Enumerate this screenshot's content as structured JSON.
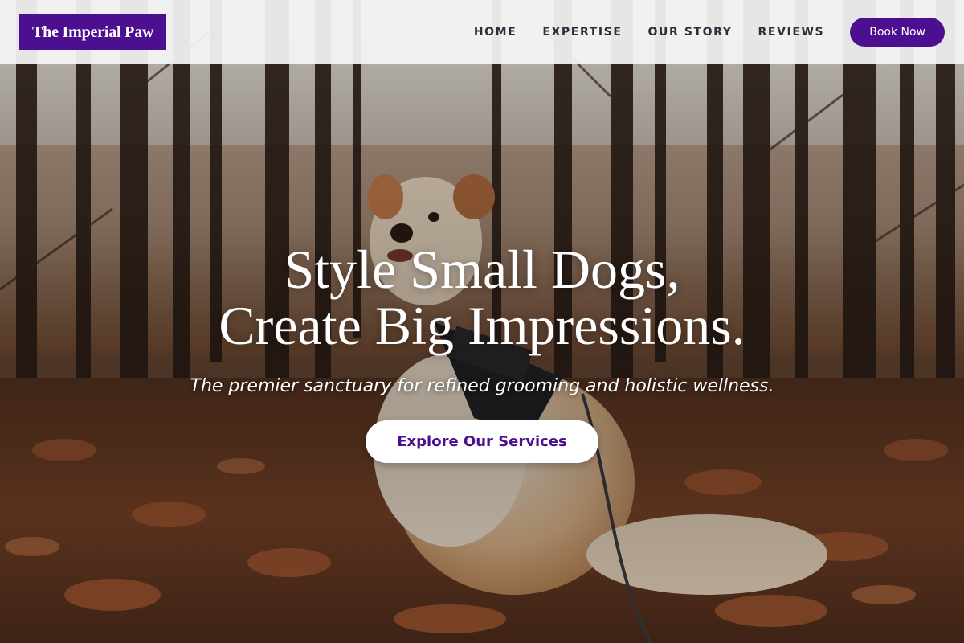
{
  "brand": {
    "name": "The Imperial Paw",
    "color": "#4b0f8f"
  },
  "nav": {
    "links": [
      "HOME",
      "EXPERTISE",
      "OUR STORY",
      "REVIEWS"
    ],
    "cta_label": "Book Now"
  },
  "hero": {
    "headline_line1": "Style Small Dogs,",
    "headline_line2": "Create Big Impressions.",
    "subheadline": "The premier sanctuary for refined grooming and holistic wellness.",
    "cta_label": "Explore Our Services",
    "background": "photo of a light-colored dog wearing a harness sitting on autumn leaves in a forest"
  },
  "colors": {
    "accent": "#4b0f8f",
    "header_bg": "#f5f5f6",
    "cta_bg": "#ffffff"
  }
}
